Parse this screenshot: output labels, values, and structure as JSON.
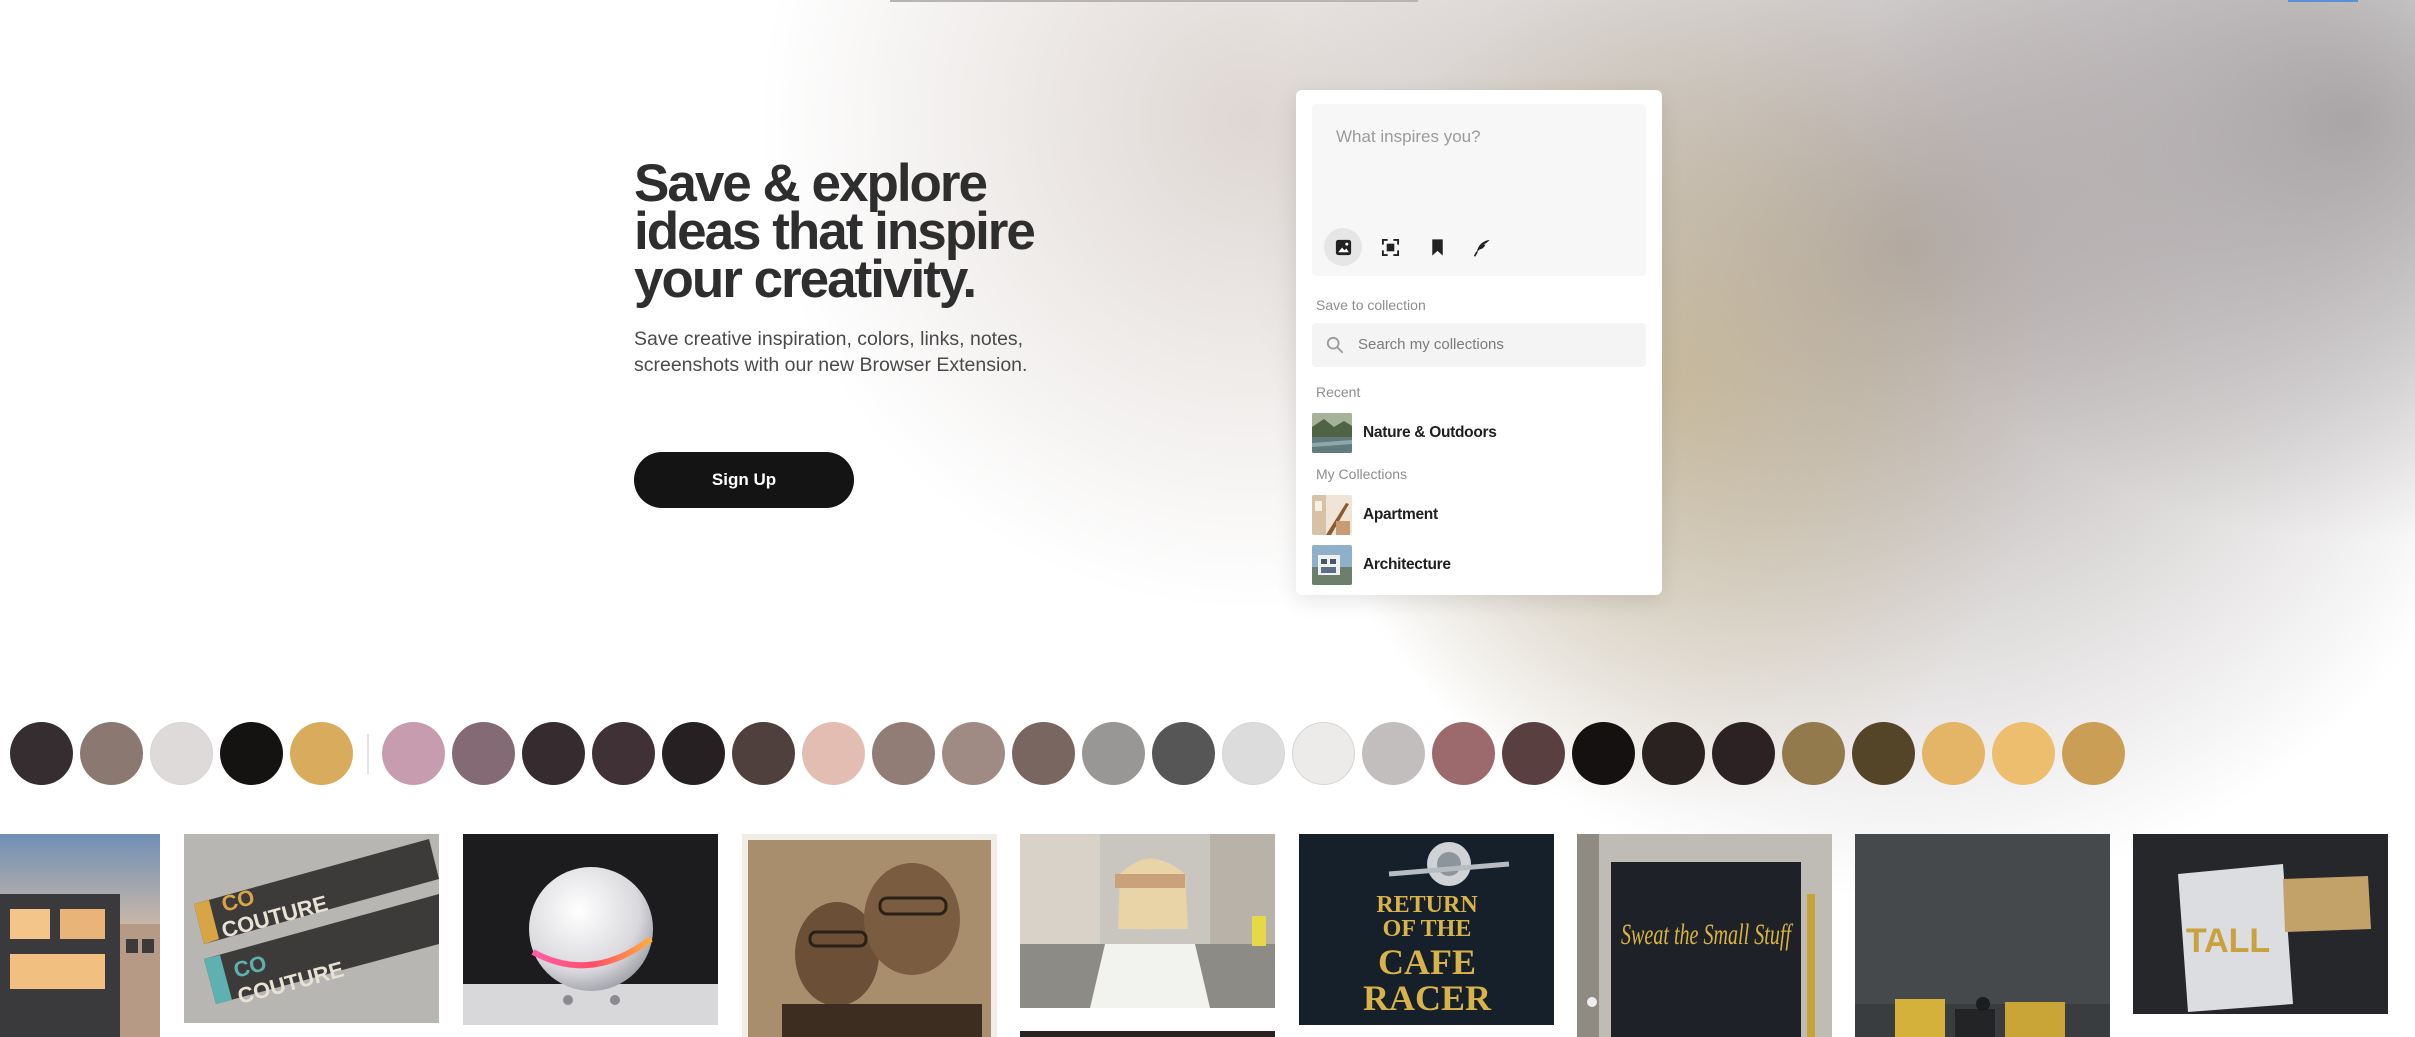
{
  "hero": {
    "title_lines": [
      "Save & explore",
      "ideas that inspire",
      "your creativity."
    ],
    "subtitle": "Save creative inspiration, colors, links, notes, screenshots with our new Browser Extension.",
    "signup_label": "Sign Up"
  },
  "extension": {
    "composer_placeholder": "What inspires you?",
    "tools": [
      {
        "icon": "image-icon",
        "active": true
      },
      {
        "icon": "screenshot-icon",
        "active": false
      },
      {
        "icon": "bookmark-icon",
        "active": false
      },
      {
        "icon": "feather-pen-icon",
        "active": false
      }
    ],
    "save_to_label": "Save to collection",
    "search_placeholder": "Search my collections",
    "recent_label": "Recent",
    "recent_items": [
      {
        "name": "Nature & Outdoors"
      }
    ],
    "my_collections_label": "My Collections",
    "collections": [
      {
        "name": "Apartment"
      },
      {
        "name": "Architecture"
      }
    ]
  },
  "palette": {
    "primary": [
      "#352d30",
      "#8b7870",
      "#dddad9",
      "#151212",
      "#d9ab5c"
    ],
    "extended": [
      "#c89caf",
      "#836a75",
      "#362c30",
      "#3f3135",
      "#262022",
      "#4f403e",
      "#e4bdb2",
      "#917d75",
      "#a08a84",
      "#7a6660",
      "#989796",
      "#575656",
      "#dcdcdc",
      "#edebea",
      "#c2bebe",
      "#9c6a6c",
      "#5a3f40",
      "#141110",
      "#2a2121",
      "#2c2223",
      "#937a4c",
      "#544428",
      "#e4b467",
      "#ecbe6d",
      "#cb9e55"
    ]
  },
  "tiles": {
    "chocolate_brand": [
      "CO",
      "COUTURE"
    ],
    "poster_text": [
      "RETURN",
      "OF THE",
      "CAFE",
      "RACER"
    ],
    "script_text": "Sweat the Small Stuff",
    "card_text": "TALL"
  }
}
